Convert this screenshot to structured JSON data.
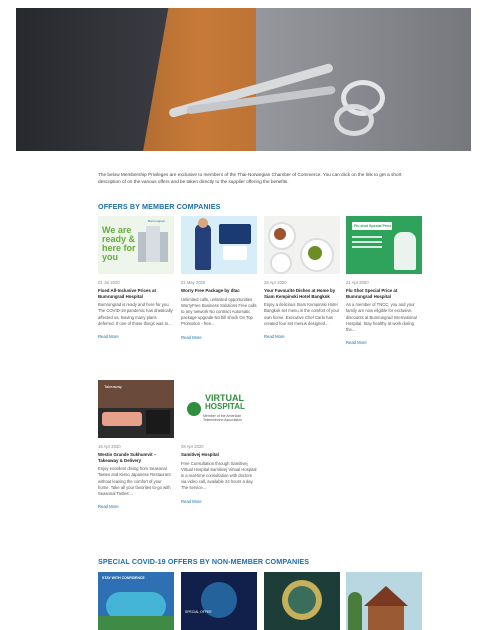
{
  "intro": {
    "text": "The below Membership Privileges are exclusive to members of the Thai-Norwegian Chamber of Commerce. You can click on the link to get a short description of on the various offers and be taken directly to the supplier offering the benefits."
  },
  "sections": {
    "members_title": "OFFERS BY MEMBER COMPANIES",
    "nonmembers_title": "SPECIAL COVID-19 OFFERS BY NON-MEMBER COMPANIES"
  },
  "cards": [
    {
      "date": "01 Jul 2020",
      "title": "Fixed All-Inclusive Prices at Bumrungrad Hospital",
      "desc": "Bumrungrad is ready and here for you. The COVID-19 pandemic has drastically affected us, leaving many plans deferred. If one of those things was to...",
      "more": "Read More",
      "thumb": {
        "w": "We are ready & here for you",
        "brand": "Bumrungrad"
      }
    },
    {
      "date": "01 May 2020",
      "title": "Worry Free Package by dtac",
      "desc": "Unlimited calls, unlimited opportunities WorryFree Business Solutions Free calls to any network No contract Automatic package upgrade No bill shock On Top Promotion - free...",
      "more": "Read More"
    },
    {
      "date": "28 Apr 2020",
      "title": "Your Favourite Dishes at Home by Siam Kempinski Hotel Bangkok",
      "desc": "Enjoy a delicious Siam Kempinski Hotel Bangkok set menu in the comfort of your own home. Executive Chef Carlo has created four set menus designed...",
      "more": "Read More"
    },
    {
      "date": "21 Apr 2020",
      "title": "Flu Shot Special Price at Bumrungrad Hospital",
      "desc": "As a member of TNCC, you and your family are now eligible for exclusive discounts at Bumrungrad International Hospital. Stay healthy at work during the...",
      "more": "Read More",
      "thumb": {
        "banner": "Flu shot Special Price"
      }
    },
    {
      "date": "16 Apr 2020",
      "title": "Westin Grande Sukhumvit – Takeaway & Delivery",
      "desc": "Enjoy excellent dining from Seasonal Tastes and Kisso Japanese Restaurant without leaving the comfort of your home. Take all your favorites to-go with Seasonal Tastes'...",
      "more": "Read More",
      "thumb": {
        "label": "Takeaway"
      }
    },
    {
      "date": "08 Apr 2020",
      "title": "Samitivej Hospital",
      "desc": "Free Consultation through Samitivej Virtual Hospital Samitivej Virtual Hospital is a real-time consultation with doctors via video call, available 24 hours a day. The service...",
      "more": "Read More",
      "thumb": {
        "v1": "VIRTUAL",
        "v2": "HOSPITAL",
        "v3": "Member of the American Telemedicine Association"
      }
    }
  ],
  "bottom_thumbs": {
    "b1": "STAY WITH CONFIDENCE",
    "b2": "SPECIAL OFFER"
  },
  "colors": {
    "accent": "#1e6fa9",
    "text": "#444444"
  }
}
